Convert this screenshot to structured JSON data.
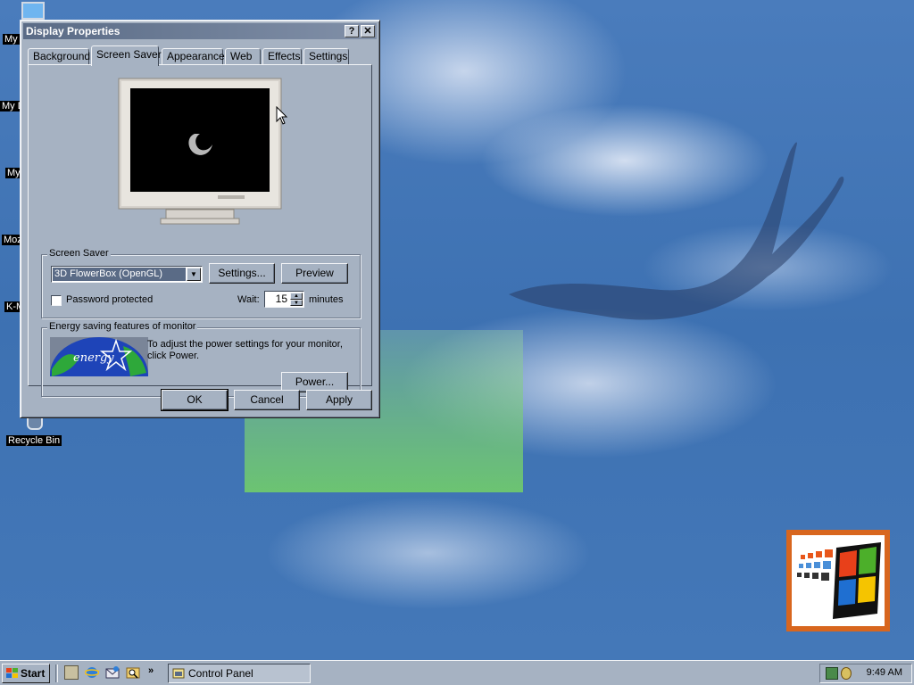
{
  "desktop": {
    "icons": [
      {
        "label": "My"
      },
      {
        "label": "My D"
      },
      {
        "label": "My"
      },
      {
        "label": "Moz"
      },
      {
        "label": "K-M"
      },
      {
        "label": "Recycle Bin"
      }
    ]
  },
  "window": {
    "title": "Display Properties",
    "help_button": "?",
    "close_button": "✕",
    "tabs": [
      {
        "label": "Background"
      },
      {
        "label": "Screen Saver"
      },
      {
        "label": "Appearance"
      },
      {
        "label": "Web"
      },
      {
        "label": "Effects"
      },
      {
        "label": "Settings"
      }
    ],
    "active_tab": "Screen Saver",
    "screensaver_group": {
      "legend": "Screen Saver",
      "selected": "3D FlowerBox (OpenGL)",
      "settings_button": "Settings...",
      "preview_button": "Preview",
      "password_label": "Password protected",
      "password_checked": false,
      "wait_label": "Wait:",
      "wait_value": "15",
      "minutes_label": "minutes"
    },
    "energy_group": {
      "legend": "Energy saving features of monitor",
      "description": "To adjust the power settings for your monitor, click Power.",
      "logo_text": "energy",
      "power_button": "Power..."
    },
    "ok_button": "OK",
    "cancel_button": "Cancel",
    "apply_button": "Apply"
  },
  "taskbar": {
    "start_label": "Start",
    "task_label": "Control Panel",
    "clock": "9:49 AM"
  },
  "colors": {
    "face": "#a6b2c2",
    "title_active": "#5a6b86",
    "desktop_blue": "#3d71b2"
  }
}
